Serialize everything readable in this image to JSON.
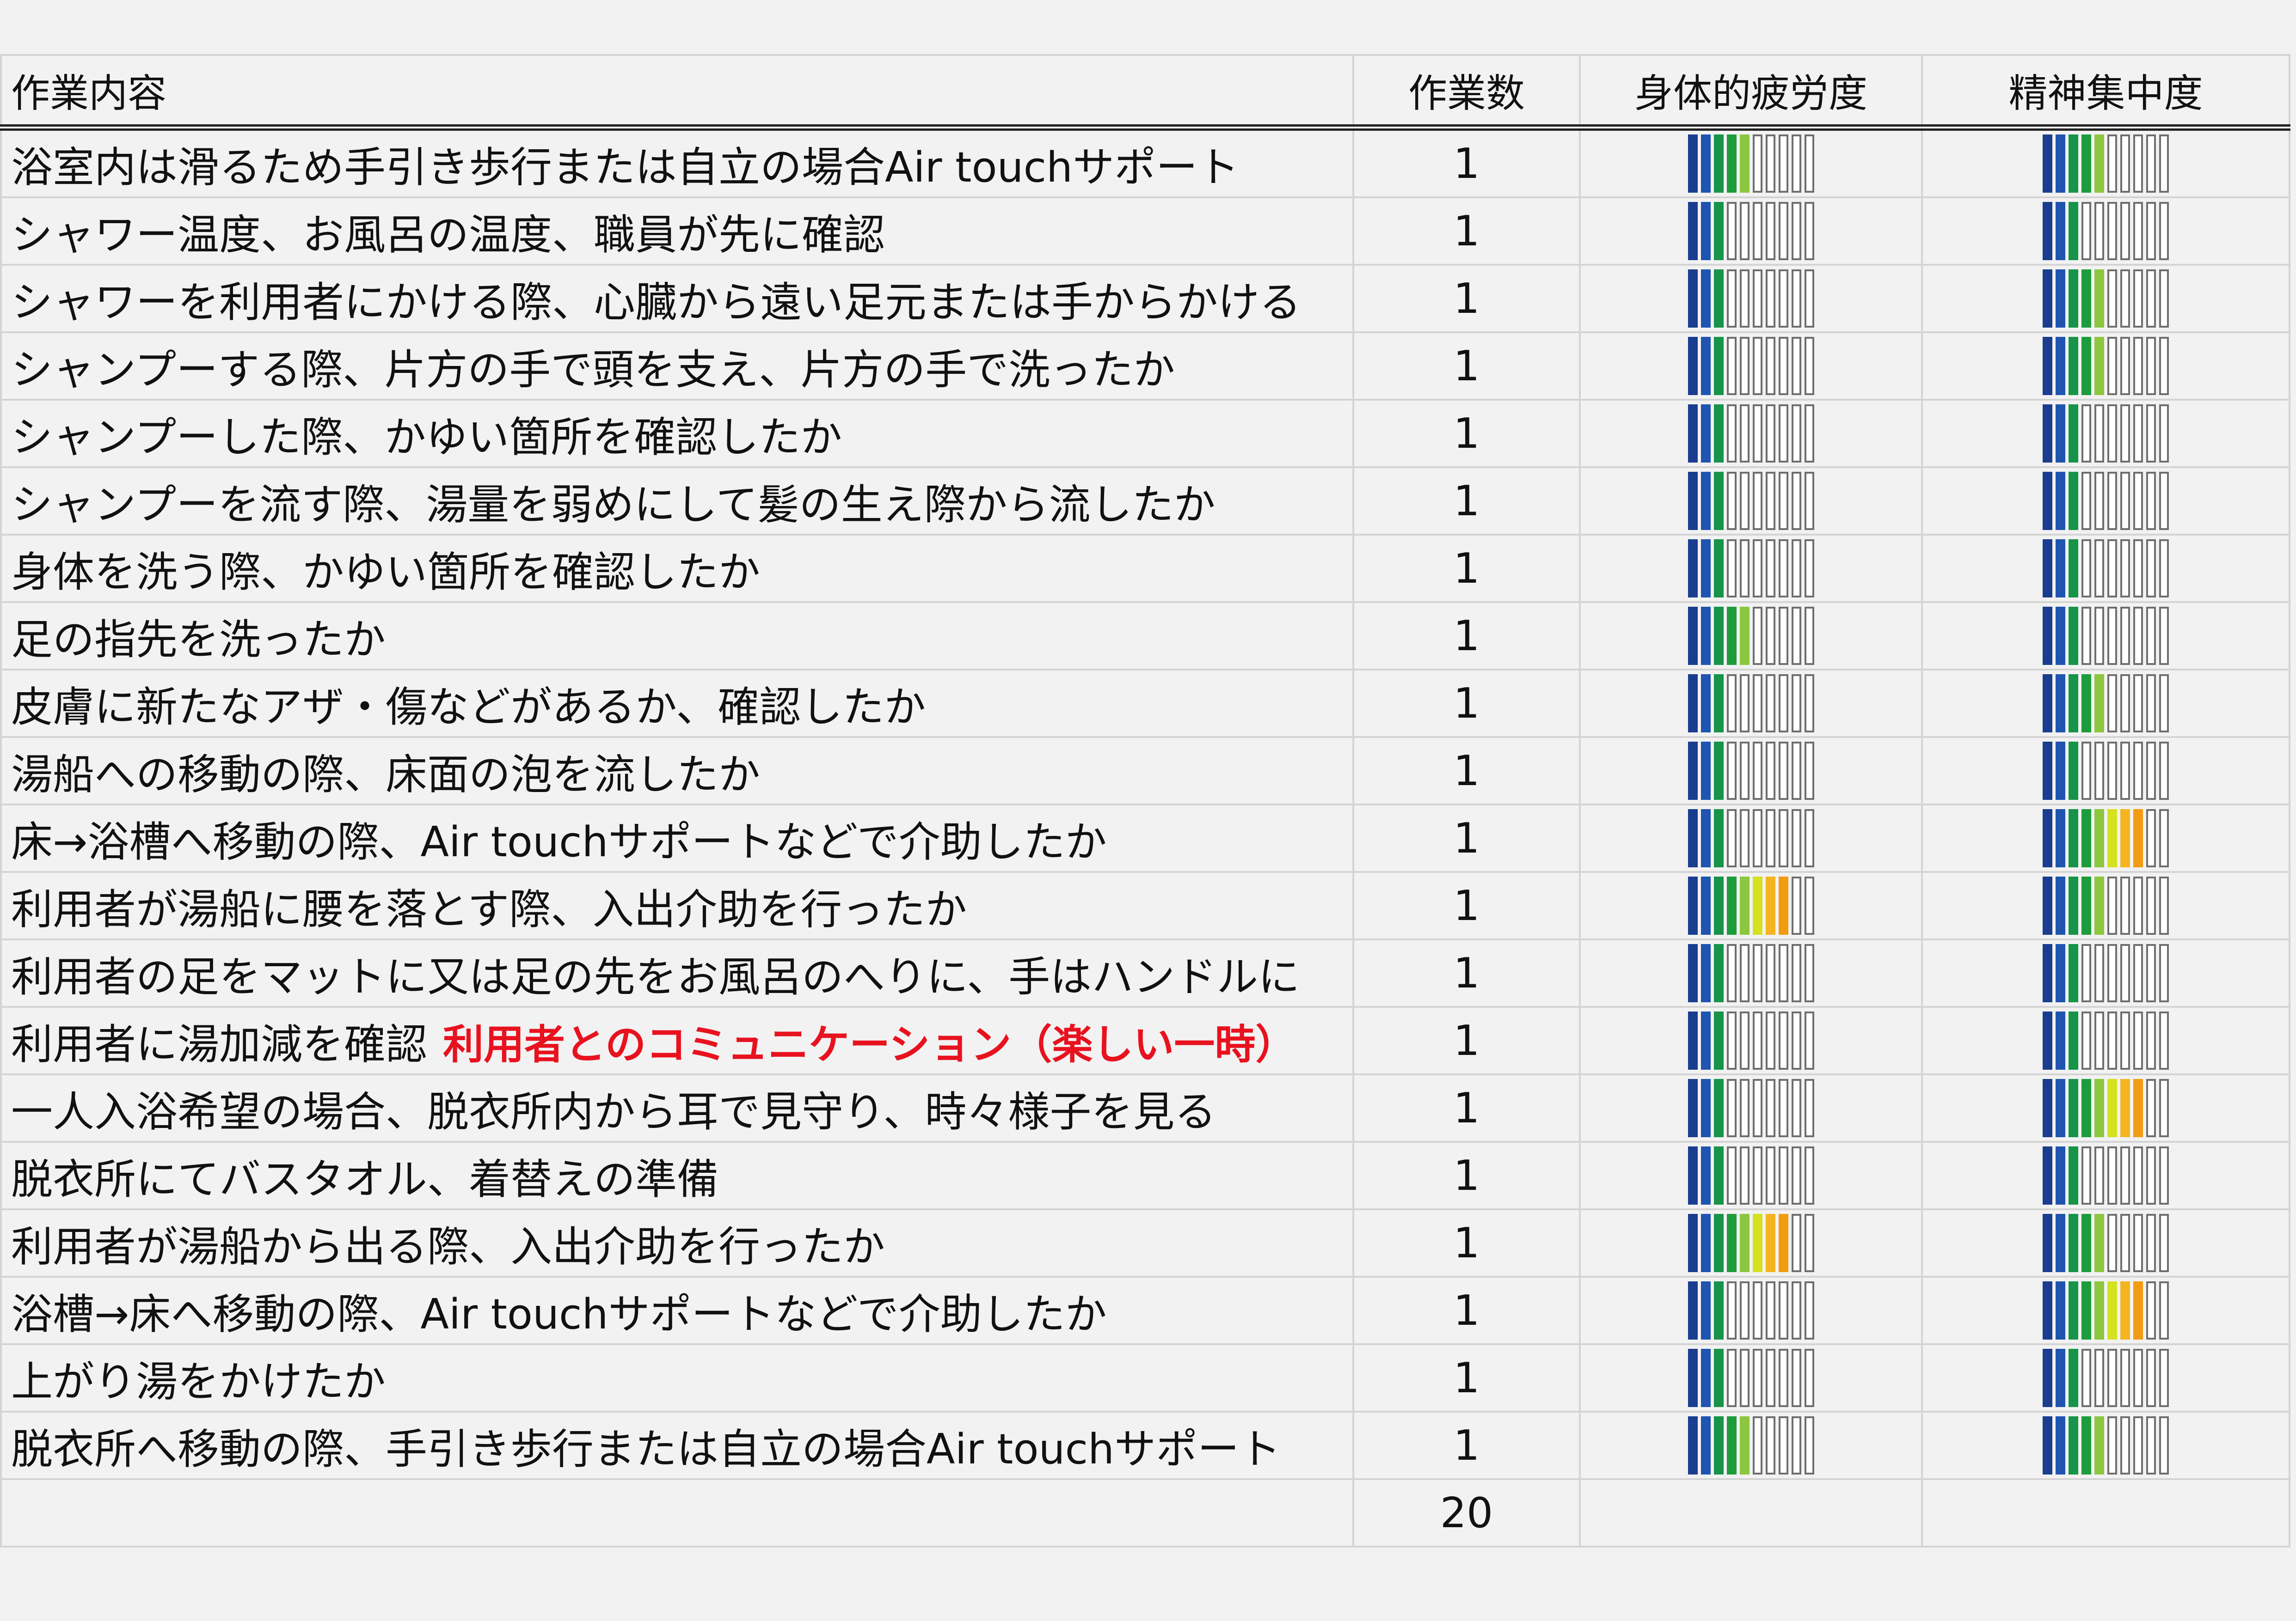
{
  "table": {
    "headers": {
      "task": "作業内容",
      "count": "作業数",
      "physical": "身体的疲労度",
      "mental": "精神集中度"
    },
    "rows": [
      {
        "task": "浴室内は滑るため手引き歩行または自立の場合Air touchサポート",
        "highlight": "",
        "count": "1",
        "physical": 5,
        "mental": 5
      },
      {
        "task": "シャワー温度、お風呂の温度、職員が先に確認",
        "highlight": "",
        "count": "1",
        "physical": 3,
        "mental": 3
      },
      {
        "task": "シャワーを利用者にかける際、心臓から遠い足元または手からかける",
        "highlight": "",
        "count": "1",
        "physical": 3,
        "mental": 5
      },
      {
        "task": "シャンプーする際、片方の手で頭を支え、片方の手で洗ったか",
        "highlight": "",
        "count": "1",
        "physical": 3,
        "mental": 5
      },
      {
        "task": "シャンプーした際、かゆい箇所を確認したか",
        "highlight": "",
        "count": "1",
        "physical": 3,
        "mental": 3
      },
      {
        "task": "シャンプーを流す際、湯量を弱めにして髪の生え際から流したか",
        "highlight": "",
        "count": "1",
        "physical": 3,
        "mental": 3
      },
      {
        "task": "身体を洗う際、かゆい箇所を確認したか",
        "highlight": "",
        "count": "1",
        "physical": 3,
        "mental": 3
      },
      {
        "task": "足の指先を洗ったか",
        "highlight": "",
        "count": "1",
        "physical": 5,
        "mental": 3
      },
      {
        "task": "皮膚に新たなアザ・傷などがあるか、確認したか",
        "highlight": "",
        "count": "1",
        "physical": 3,
        "mental": 5
      },
      {
        "task": "湯船への移動の際、床面の泡を流したか",
        "highlight": "",
        "count": "1",
        "physical": 3,
        "mental": 3
      },
      {
        "task": "床→浴槽へ移動の際、Air touchサポートなどで介助したか",
        "highlight": "",
        "count": "1",
        "physical": 3,
        "mental": 8
      },
      {
        "task": "利用者が湯船に腰を落とす際、入出介助を行ったか",
        "highlight": "",
        "count": "1",
        "physical": 8,
        "mental": 5
      },
      {
        "task": "利用者の足をマットに又は足の先をお風呂のへりに、手はハンドルに",
        "highlight": "",
        "count": "1",
        "physical": 3,
        "mental": 3
      },
      {
        "task": "利用者に湯加減を確認",
        "highlight": "利用者とのコミュニケーション（楽しい一時）",
        "count": "1",
        "physical": 3,
        "mental": 3
      },
      {
        "task": "一人入浴希望の場合、脱衣所内から耳で見守り、時々様子を見る",
        "highlight": "",
        "count": "1",
        "physical": 3,
        "mental": 8
      },
      {
        "task": "脱衣所にてバスタオル、着替えの準備",
        "highlight": "",
        "count": "1",
        "physical": 3,
        "mental": 3
      },
      {
        "task": "利用者が湯船から出る際、入出介助を行ったか",
        "highlight": "",
        "count": "1",
        "physical": 8,
        "mental": 5
      },
      {
        "task": "浴槽→床へ移動の際、Air touchサポートなどで介助したか",
        "highlight": "",
        "count": "1",
        "physical": 3,
        "mental": 8
      },
      {
        "task": "上がり湯をかけたか",
        "highlight": "",
        "count": "1",
        "physical": 3,
        "mental": 3
      },
      {
        "task": "脱衣所へ移動の際、手引き歩行または自立の場合Air touchサポート",
        "highlight": "",
        "count": "1",
        "physical": 5,
        "mental": 5
      }
    ],
    "total_count": "20"
  },
  "meter": {
    "segments_total": 10,
    "colors": [
      "#1a3d8f",
      "#1f54b0",
      "#17934a",
      "#1d9c3c",
      "#8dc63f",
      "#d4e21f",
      "#f4b521",
      "#f39c12",
      "#e98a0c",
      "#e07b0b"
    ]
  }
}
